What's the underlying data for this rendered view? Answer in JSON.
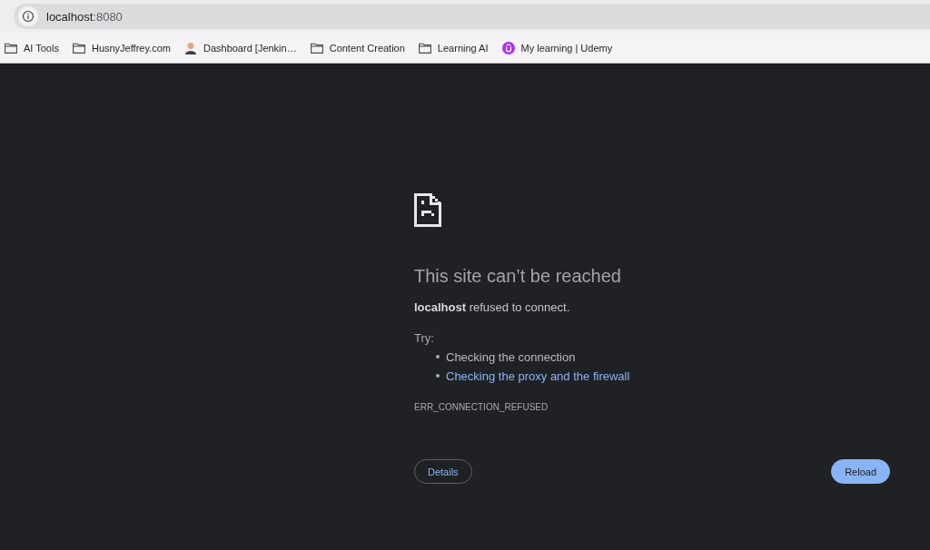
{
  "address_bar": {
    "host": "localhost",
    "suffix": ":8080"
  },
  "bookmarks": [
    {
      "kind": "folder",
      "label": "AI Tools"
    },
    {
      "kind": "folder",
      "label": "HusnyJeffrey.com"
    },
    {
      "kind": "avatar",
      "label": "Dashboard [Jenkin…"
    },
    {
      "kind": "folder",
      "label": "Content Creation"
    },
    {
      "kind": "folder",
      "label": "Learning AI"
    },
    {
      "kind": "badge",
      "label": "My learning | Udemy"
    }
  ],
  "error": {
    "title": "This site can’t be reached",
    "message": "**localhost** refused to connect.",
    "try_label": "Try:",
    "suggestions": [
      {
        "kind": "text",
        "text": "Checking the connection"
      },
      {
        "kind": "link",
        "text": "Checking the proxy and the firewall"
      }
    ],
    "code": "ERR_CONNECTION_REFUSED"
  },
  "buttons": [
    {
      "kind": "outline",
      "label": "Details"
    },
    {
      "kind": "filled",
      "label": "Reload"
    }
  ]
}
